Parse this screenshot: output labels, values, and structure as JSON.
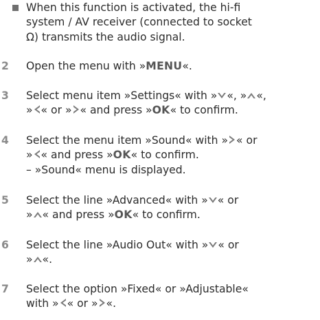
{
  "bullet": {
    "line1": "When this function is activated, the hi-fi",
    "line2": "system / AV receiver (connected to socket",
    "line3_glyph": "Ω",
    "line3_text": ") transmits the audio signal."
  },
  "steps": [
    {
      "num": "2",
      "l1_a": "Open the menu with »",
      "l1_key": "MENU",
      "l1_b": "«."
    },
    {
      "num": "3",
      "l1_a": "Select menu item »Settings« with »",
      "l1_sep1": "«, »",
      "l1_sep2": "«,",
      "l2_a": "»",
      "l2_sep1": "« or »",
      "l2_b": "« and press »",
      "l2_key": "OK",
      "l2_c": "« to confirm."
    },
    {
      "num": "4",
      "l1_a": "Select the menu item »Sound« with »",
      "l1_b": "« or",
      "l2_a": "»",
      "l2_b": "« and press »",
      "l2_key": "OK",
      "l2_c": "« to confirm.",
      "l3": "– »Sound« menu is displayed."
    },
    {
      "num": "5",
      "l1_a": "Select the line »Advanced« with »",
      "l1_b": "« or",
      "l2_a": "»",
      "l2_b": "« and press »",
      "l2_key": "OK",
      "l2_c": "« to confirm."
    },
    {
      "num": "6",
      "l1_a": "Select the line »Audio Out« with »",
      "l1_b": "« or",
      "l2_a": "»",
      "l2_b": "«."
    },
    {
      "num": "7",
      "l1": "Select the option »Fixed« or »Adjustable«",
      "l2_a": "with »",
      "l2_sep": "« or »",
      "l2_b": "«."
    }
  ],
  "icons": {
    "down": "arrow-down-icon",
    "up": "arrow-up-icon",
    "left": "arrow-left-icon",
    "right": "arrow-right-icon",
    "headphone": "headphone-socket-icon"
  },
  "colors": {
    "text": "#2b2b2b",
    "number": "#8a8a8a",
    "bullet": "#6f6f6f",
    "arrow": "#7a7a7a"
  }
}
